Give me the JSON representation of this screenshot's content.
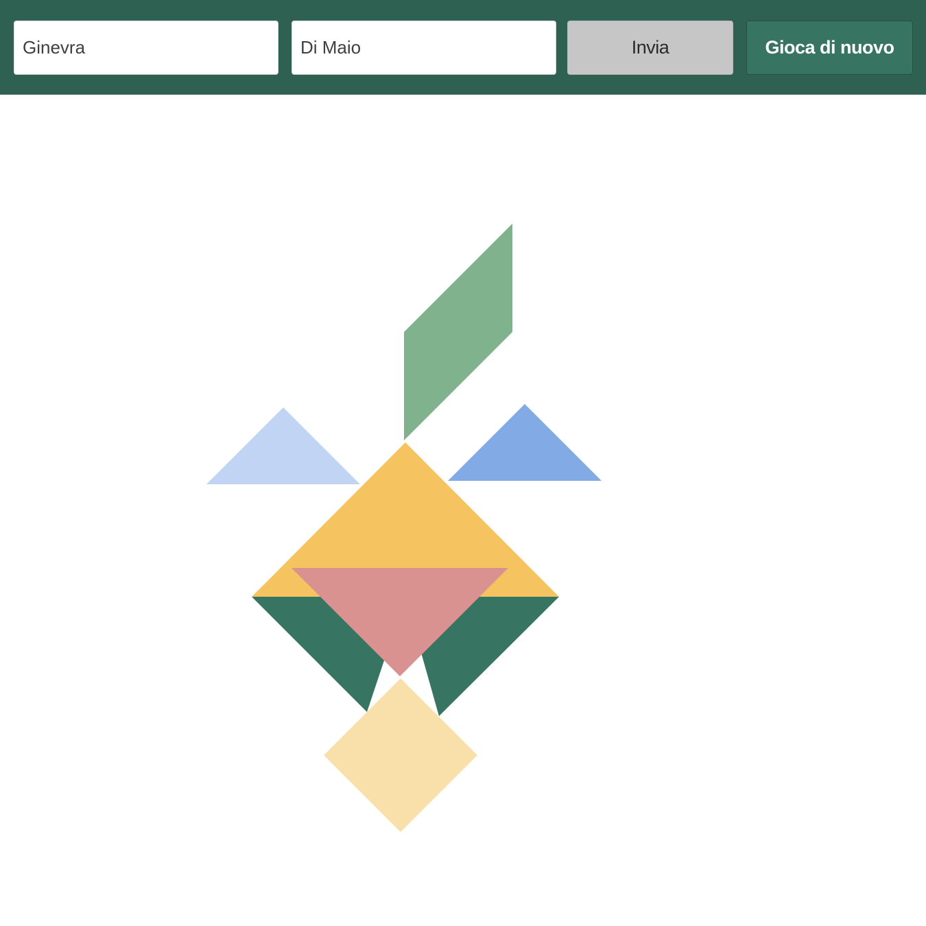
{
  "form": {
    "first_name": "Ginevra",
    "last_name": "Di Maio",
    "submit_label": "Invia",
    "replay_label": "Gioca di nuovo"
  },
  "tangram": {
    "pieces": [
      {
        "name": "parallelogram-piece",
        "shape": "parallelogram",
        "color": "#80b28d"
      },
      {
        "name": "small-triangle-left-piece",
        "shape": "small-triangle",
        "color": "#c1d4f3"
      },
      {
        "name": "small-triangle-right-piece",
        "shape": "small-triangle",
        "color": "#82aae5"
      },
      {
        "name": "large-triangle-left-piece",
        "shape": "large-triangle",
        "color": "#387462"
      },
      {
        "name": "large-triangle-right-piece",
        "shape": "large-triangle",
        "color": "#387462"
      },
      {
        "name": "large-triangle-top-piece",
        "shape": "large-triangle",
        "color": "#f5c461"
      },
      {
        "name": "medium-triangle-piece",
        "shape": "medium-triangle",
        "color": "#d99290"
      },
      {
        "name": "square-piece",
        "shape": "square",
        "color": "#f9e0ab"
      }
    ]
  }
}
